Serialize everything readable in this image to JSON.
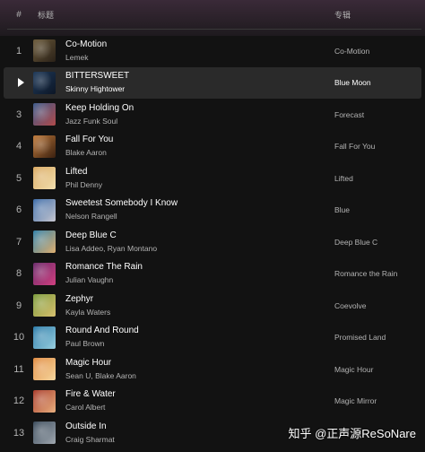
{
  "header": {
    "num_label": "#",
    "title_label": "标题",
    "album_label": "专辑"
  },
  "tracks": [
    {
      "num": "1",
      "title": "Co-Motion",
      "artist": "Lemek",
      "album": "Co-Motion",
      "cover_colors": [
        "#6b5a3a",
        "#2a2118"
      ]
    },
    {
      "num": "2",
      "title": "BITTERSWEET",
      "artist": "Skinny Hightower",
      "album": "Blue Moon",
      "active": true,
      "cover_colors": [
        "#1f3a5a",
        "#0c1626"
      ]
    },
    {
      "num": "3",
      "title": "Keep Holding On",
      "artist": "Jazz Funk Soul",
      "album": "Forecast",
      "cover_colors": [
        "#3c5a8a",
        "#b14a4a"
      ]
    },
    {
      "num": "4",
      "title": "Fall For You",
      "artist": "Blake Aaron",
      "album": "Fall For You",
      "cover_colors": [
        "#c07a3a",
        "#3a2010"
      ]
    },
    {
      "num": "5",
      "title": "Lifted",
      "artist": "Phil Denny",
      "album": "Lifted",
      "cover_colors": [
        "#d9a860",
        "#f2e0b0"
      ]
    },
    {
      "num": "6",
      "title": "Sweetest Somebody I Know",
      "artist": "Nelson Rangell",
      "album": "Blue",
      "cover_colors": [
        "#3a6aa8",
        "#c8c8d0"
      ]
    },
    {
      "num": "7",
      "title": "Deep Blue C",
      "artist": "Lisa Addeo, Ryan Montano",
      "album": "Deep Blue C",
      "cover_colors": [
        "#2f7fa8",
        "#e0b070"
      ]
    },
    {
      "num": "8",
      "title": "Romance The Rain",
      "artist": "Julian Vaughn",
      "album": "Romance the Rain",
      "cover_colors": [
        "#6a2a6a",
        "#d04080"
      ]
    },
    {
      "num": "9",
      "title": "Zephyr",
      "artist": "Kayla Waters",
      "album": "Coevolve",
      "cover_colors": [
        "#7a9a3a",
        "#d8c070"
      ]
    },
    {
      "num": "10",
      "title": "Round And Round",
      "artist": "Paul Brown",
      "album": "Promised Land",
      "cover_colors": [
        "#2a7aa8",
        "#9ad0e0"
      ]
    },
    {
      "num": "11",
      "title": "Magic Hour",
      "artist": "Sean U, Blake Aaron",
      "album": "Magic Hour",
      "cover_colors": [
        "#e08a40",
        "#f6d8a0"
      ]
    },
    {
      "num": "12",
      "title": "Fire & Water",
      "artist": "Carol Albert",
      "album": "Magic Mirror",
      "cover_colors": [
        "#a83a2a",
        "#e8b080"
      ]
    },
    {
      "num": "13",
      "title": "Outside In",
      "artist": "Craig Sharmat",
      "album": "",
      "cover_colors": [
        "#3a4a5a",
        "#a0a8b0"
      ]
    }
  ],
  "watermark": "知乎 @正声源ReSoNare",
  "colors": {
    "background": "#121212",
    "active_row": "#2a2a2a",
    "title_text": "#ffffff",
    "secondary_text": "#b3b3b3"
  }
}
